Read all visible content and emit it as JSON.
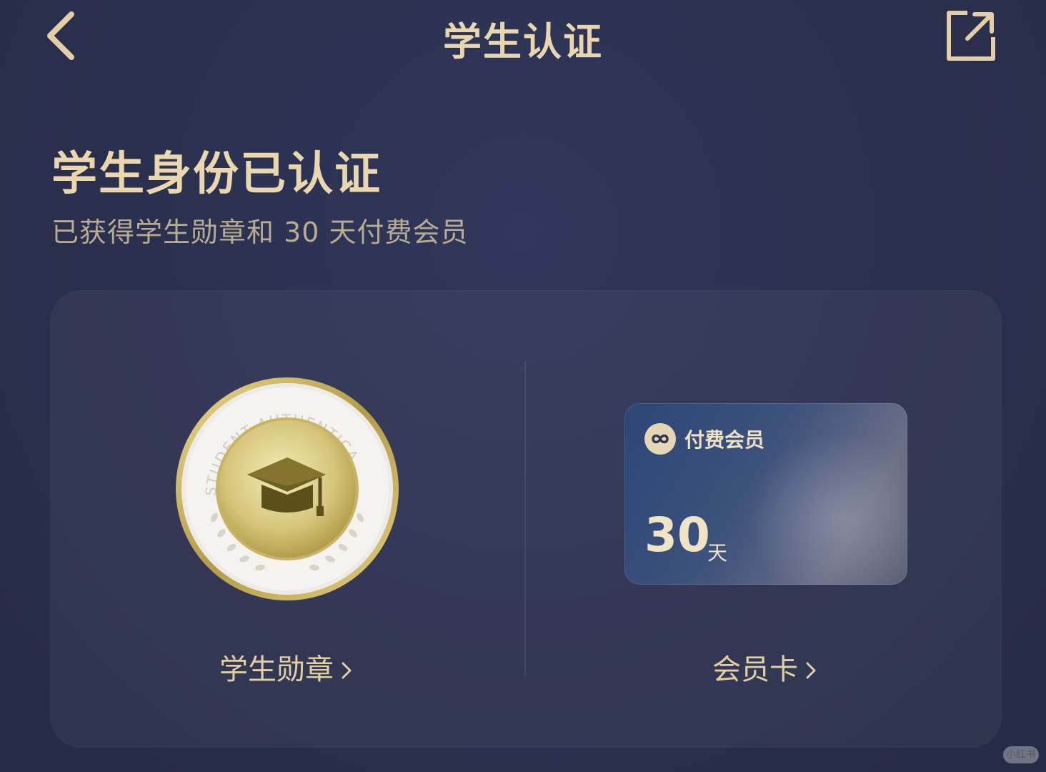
{
  "nav": {
    "title": "学生认证",
    "back_icon": "chevron-left-icon",
    "share_icon": "share-external-icon"
  },
  "hero": {
    "title": "学生身份已认证",
    "subtitle": "已获得学生勋章和 30 天付费会员"
  },
  "badge": {
    "ring_text": "STUDENT AUTHENTICA",
    "icon": "graduation-cap-icon",
    "label": "学生勋章"
  },
  "membership_card": {
    "title": "付费会员",
    "days": "30",
    "unit": "天",
    "label": "会员卡",
    "logo_icon": "infinity-icon"
  },
  "colors": {
    "background": "#2b3150",
    "gold_text": "#e2cfa5",
    "card_blue": "#2c4676"
  },
  "watermark": "小红书"
}
